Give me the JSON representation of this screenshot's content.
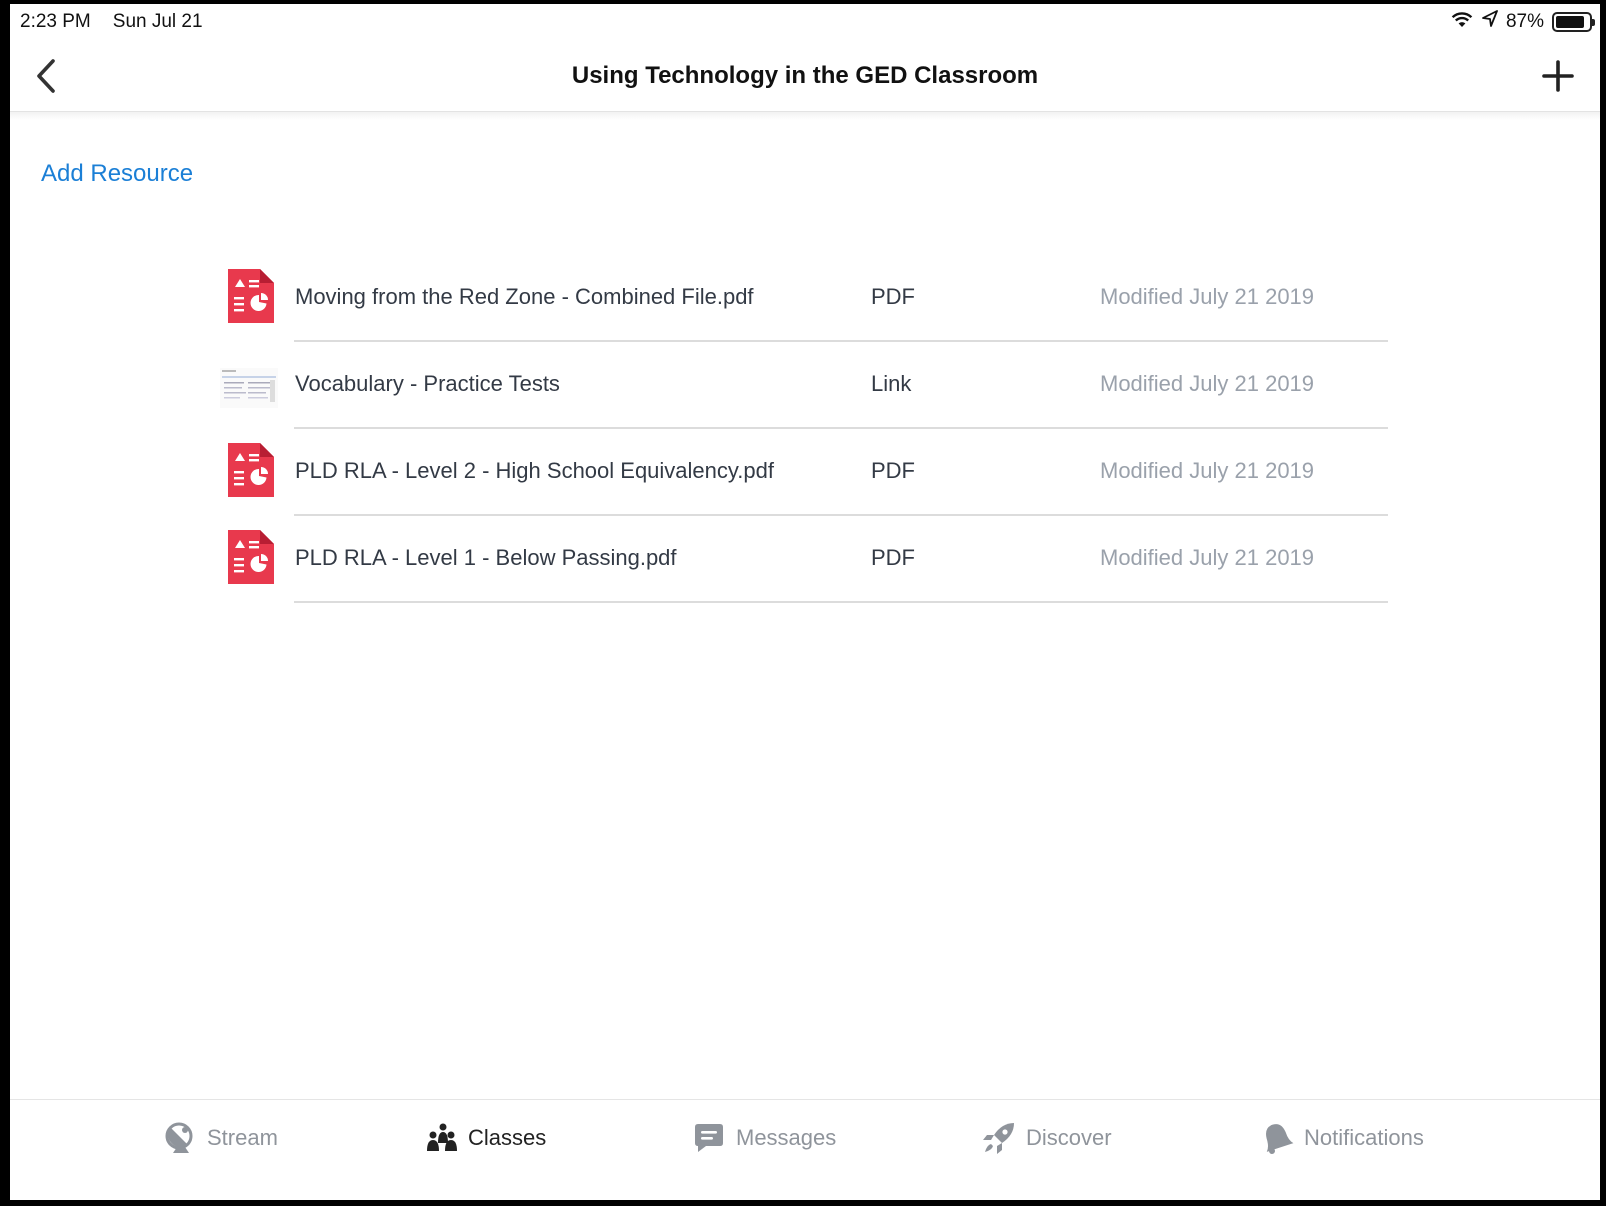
{
  "status_bar": {
    "time": "2:23 PM",
    "date": "Sun Jul 21",
    "battery_text": "87%",
    "battery_level": 0.87
  },
  "nav": {
    "title": "Using Technology in the GED Classroom",
    "back_icon": "chevron-left-icon",
    "add_icon": "plus-icon"
  },
  "add_resource_label": "Add Resource",
  "resources": [
    {
      "name": "Moving from the Red Zone - Combined File.pdf",
      "type": "PDF",
      "modified": "Modified July 21 2019",
      "icon": "pdf-file-icon"
    },
    {
      "name": "Vocabulary - Practice Tests",
      "type": "Link",
      "modified": "Modified July 21 2019",
      "icon": "link-thumbnail"
    },
    {
      "name": "PLD RLA - Level 2 - High School Equivalency.pdf",
      "type": "PDF",
      "modified": "Modified July 21 2019",
      "icon": "pdf-file-icon"
    },
    {
      "name": "PLD RLA - Level 1 - Below Passing.pdf",
      "type": "PDF",
      "modified": "Modified July 21 2019",
      "icon": "pdf-file-icon"
    }
  ],
  "tabs": [
    {
      "label": "Stream",
      "icon": "satellite-dish-icon",
      "active": false
    },
    {
      "label": "Classes",
      "icon": "classes-people-icon",
      "active": true
    },
    {
      "label": "Messages",
      "icon": "chat-bubble-icon",
      "active": false
    },
    {
      "label": "Discover",
      "icon": "rocket-icon",
      "active": false
    },
    {
      "label": "Notifications",
      "icon": "bell-icon",
      "active": false
    }
  ],
  "colors": {
    "accent": "#1b7fd6",
    "pdf_red": "#e8394d",
    "text_primary": "#333a45",
    "text_secondary": "#9aa1ab",
    "tab_inactive": "#8f949b"
  }
}
